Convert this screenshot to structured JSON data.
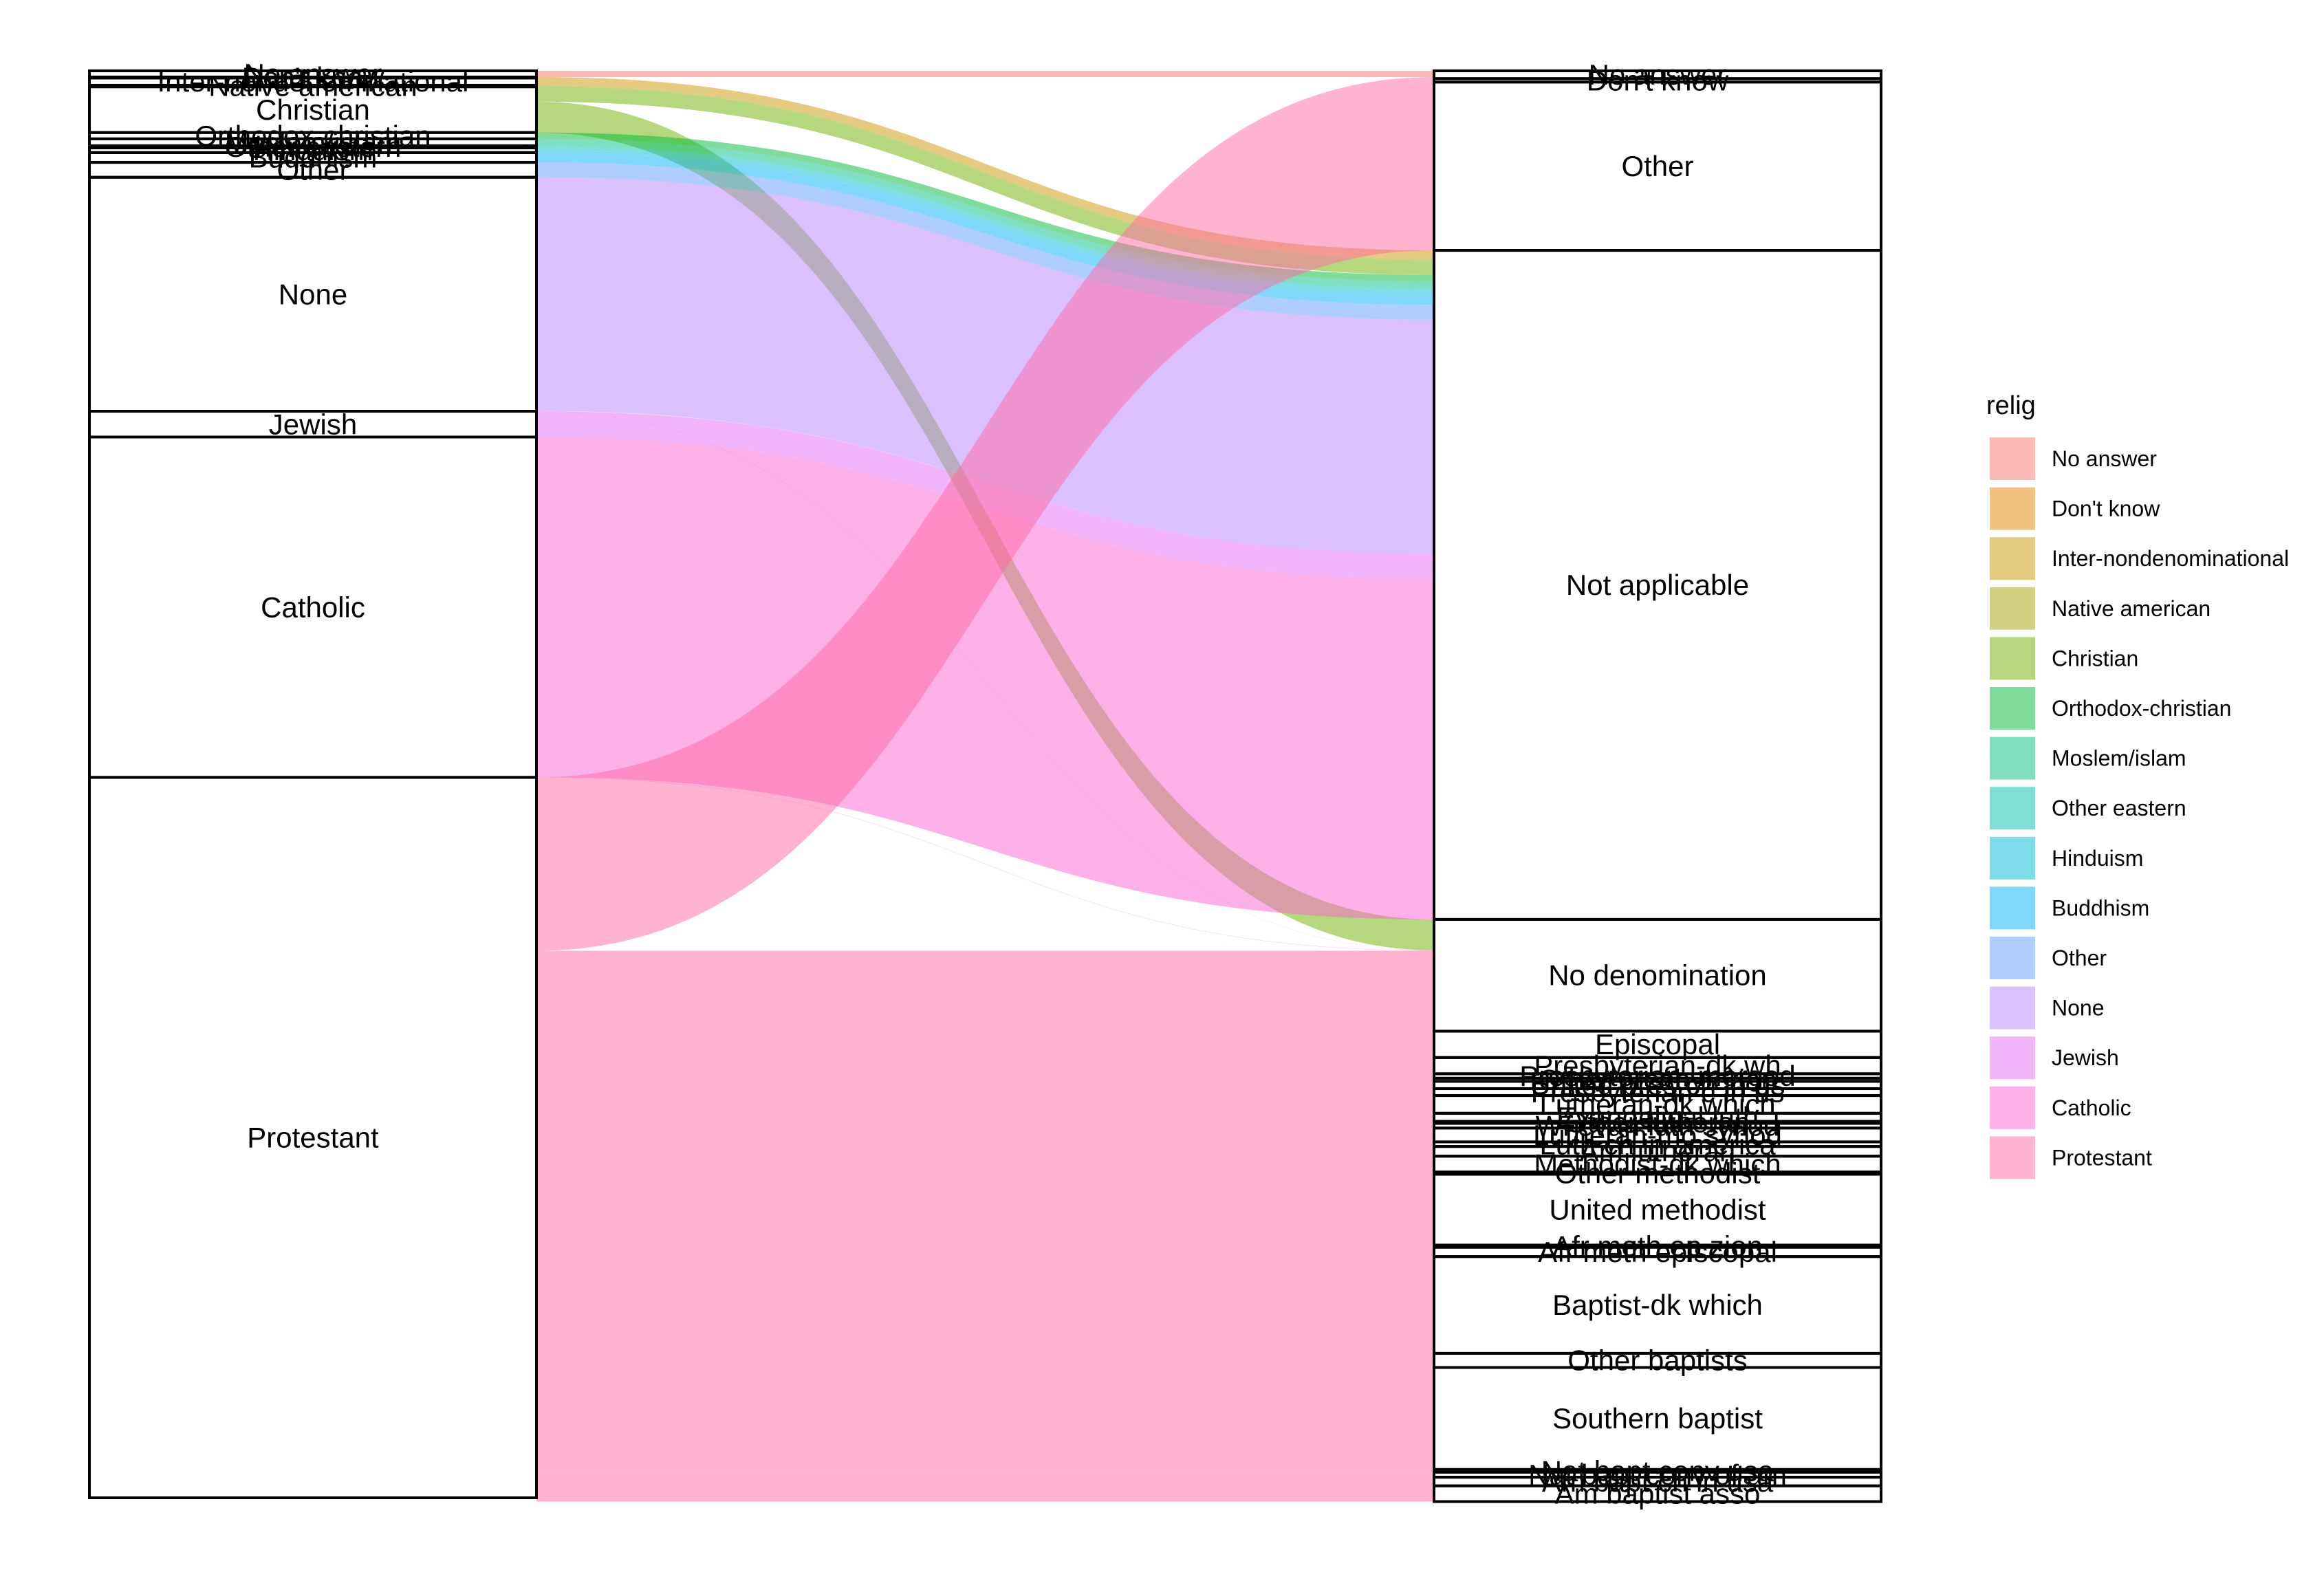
{
  "chart_data": {
    "type": "alluvial",
    "axes": [
      "relig",
      "denom"
    ],
    "legend": {
      "title": "relig",
      "placement": "right"
    },
    "relig": [
      {
        "name": "No answer",
        "color": "#F8766D",
        "count": 93
      },
      {
        "name": "Don't know",
        "color": "#E58700",
        "count": 15
      },
      {
        "name": "Inter-nondenominational",
        "color": "#C99800",
        "count": 109
      },
      {
        "name": "Native american",
        "color": "#A3A500",
        "count": 23
      },
      {
        "name": "Christian",
        "color": "#6BB100",
        "count": 689
      },
      {
        "name": "Orthodox-christian",
        "color": "#00BA38",
        "count": 95
      },
      {
        "name": "Moslem/islam",
        "color": "#00BF7D",
        "count": 104
      },
      {
        "name": "Other eastern",
        "color": "#00C0AF",
        "count": 32
      },
      {
        "name": "Hinduism",
        "color": "#00BCD8",
        "count": 71
      },
      {
        "name": "Buddhism",
        "color": "#00B0F6",
        "count": 147
      },
      {
        "name": "Other",
        "color": "#619CFF",
        "count": 224
      },
      {
        "name": "None",
        "color": "#B983FF",
        "count": 3523
      },
      {
        "name": "Jewish",
        "color": "#E76BF3",
        "count": 388
      },
      {
        "name": "Catholic",
        "color": "#FD61D1",
        "count": 5124
      },
      {
        "name": "Protestant",
        "color": "#FF67A4",
        "count": 10846
      }
    ],
    "denom": [
      {
        "name": "No answer",
        "count": 117
      },
      {
        "name": "Don't know",
        "count": 52
      },
      {
        "name": "Other",
        "count": 2534
      },
      {
        "name": "Not applicable",
        "count": 10072
      },
      {
        "name": "No denomination",
        "count": 1683
      },
      {
        "name": "Episcopal",
        "count": 397
      },
      {
        "name": "Presbyterian-dk wh",
        "count": 244
      },
      {
        "name": "Presbyterian, merged",
        "count": 67
      },
      {
        "name": "Other presbyterian",
        "count": 47
      },
      {
        "name": "United pres ch in us",
        "count": 110
      },
      {
        "name": "Presbyterian c in us",
        "count": 104
      },
      {
        "name": "Lutheran-dk which",
        "count": 267
      },
      {
        "name": "Evangelical luth",
        "count": 122
      },
      {
        "name": "Other lutheran",
        "count": 30
      },
      {
        "name": "Wi evan luth synod",
        "count": 71
      },
      {
        "name": "Lutheran-mo synod",
        "count": 208
      },
      {
        "name": "Luth ch in america",
        "count": 69
      },
      {
        "name": "Am lutheran",
        "count": 146
      },
      {
        "name": "Methodist-dk which",
        "count": 239
      },
      {
        "name": "Other methodist",
        "count": 33
      },
      {
        "name": "United methodist",
        "count": 1067
      },
      {
        "name": "Afr meth ep zion",
        "count": 32
      },
      {
        "name": "Afr meth episcopal",
        "count": 140
      },
      {
        "name": "Baptist-dk which",
        "count": 1457
      },
      {
        "name": "Other baptists",
        "count": 213
      },
      {
        "name": "Southern baptist",
        "count": 1536
      },
      {
        "name": "Nat bapt conv usa",
        "count": 40
      },
      {
        "name": "Nat bapt conv of am",
        "count": 76
      },
      {
        "name": "Am bapt ch in usa",
        "count": 130
      },
      {
        "name": "Am baptist asso",
        "count": 237
      }
    ],
    "flows": [
      {
        "from": "No answer",
        "to": "No answer",
        "value": 93
      },
      {
        "from": "Don't know",
        "to": "Not applicable",
        "value": 15
      },
      {
        "from": "Inter-nondenominational",
        "to": "Not applicable",
        "value": 109
      },
      {
        "from": "Native american",
        "to": "Not applicable",
        "value": 23
      },
      {
        "from": "Christian",
        "to": "Not applicable",
        "value": 224
      },
      {
        "from": "Christian",
        "to": "No denomination",
        "value": 465
      },
      {
        "from": "Orthodox-christian",
        "to": "Not applicable",
        "value": 95
      },
      {
        "from": "Moslem/islam",
        "to": "Not applicable",
        "value": 104
      },
      {
        "from": "Other eastern",
        "to": "Not applicable",
        "value": 32
      },
      {
        "from": "Hinduism",
        "to": "Not applicable",
        "value": 71
      },
      {
        "from": "Buddhism",
        "to": "Not applicable",
        "value": 147
      },
      {
        "from": "Other",
        "to": "Not applicable",
        "value": 224
      },
      {
        "from": "None",
        "to": "Not applicable",
        "value": 3520
      },
      {
        "from": "None",
        "to": "No denomination",
        "value": 3
      },
      {
        "from": "Jewish",
        "to": "Not applicable",
        "value": 388
      },
      {
        "from": "Catholic",
        "to": "Not applicable",
        "value": 5120
      },
      {
        "from": "Catholic",
        "to": "No denomination",
        "value": 4
      },
      {
        "from": "Protestant",
        "to": "No answer",
        "value": 24
      },
      {
        "from": "Protestant",
        "to": "Don't know",
        "value": 52
      },
      {
        "from": "Protestant",
        "to": "Other",
        "value": 2534
      },
      {
        "from": "Protestant",
        "to": "No denomination",
        "value": 1211
      },
      {
        "from": "Protestant",
        "to": "Episcopal",
        "value": 397
      },
      {
        "from": "Protestant",
        "to": "Presbyterian-dk wh",
        "value": 244
      },
      {
        "from": "Protestant",
        "to": "Presbyterian, merged",
        "value": 67
      },
      {
        "from": "Protestant",
        "to": "Other presbyterian",
        "value": 47
      },
      {
        "from": "Protestant",
        "to": "United pres ch in us",
        "value": 110
      },
      {
        "from": "Protestant",
        "to": "Presbyterian c in us",
        "value": 104
      },
      {
        "from": "Protestant",
        "to": "Lutheran-dk which",
        "value": 267
      },
      {
        "from": "Protestant",
        "to": "Evangelical luth",
        "value": 122
      },
      {
        "from": "Protestant",
        "to": "Other lutheran",
        "value": 30
      },
      {
        "from": "Protestant",
        "to": "Wi evan luth synod",
        "value": 71
      },
      {
        "from": "Protestant",
        "to": "Lutheran-mo synod",
        "value": 208
      },
      {
        "from": "Protestant",
        "to": "Luth ch in america",
        "value": 69
      },
      {
        "from": "Protestant",
        "to": "Am lutheran",
        "value": 146
      },
      {
        "from": "Protestant",
        "to": "Methodist-dk which",
        "value": 239
      },
      {
        "from": "Protestant",
        "to": "Other methodist",
        "value": 33
      },
      {
        "from": "Protestant",
        "to": "United methodist",
        "value": 1067
      },
      {
        "from": "Protestant",
        "to": "Afr meth ep zion",
        "value": 32
      },
      {
        "from": "Protestant",
        "to": "Afr meth episcopal",
        "value": 140
      },
      {
        "from": "Protestant",
        "to": "Baptist-dk which",
        "value": 1457
      },
      {
        "from": "Protestant",
        "to": "Other baptists",
        "value": 213
      },
      {
        "from": "Protestant",
        "to": "Southern baptist",
        "value": 1536
      },
      {
        "from": "Protestant",
        "to": "Nat bapt conv usa",
        "value": 40
      },
      {
        "from": "Protestant",
        "to": "Nat bapt conv of am",
        "value": 76
      },
      {
        "from": "Protestant",
        "to": "Am bapt ch in usa",
        "value": 130
      },
      {
        "from": "Protestant",
        "to": "Am baptist asso",
        "value": 237
      }
    ]
  }
}
